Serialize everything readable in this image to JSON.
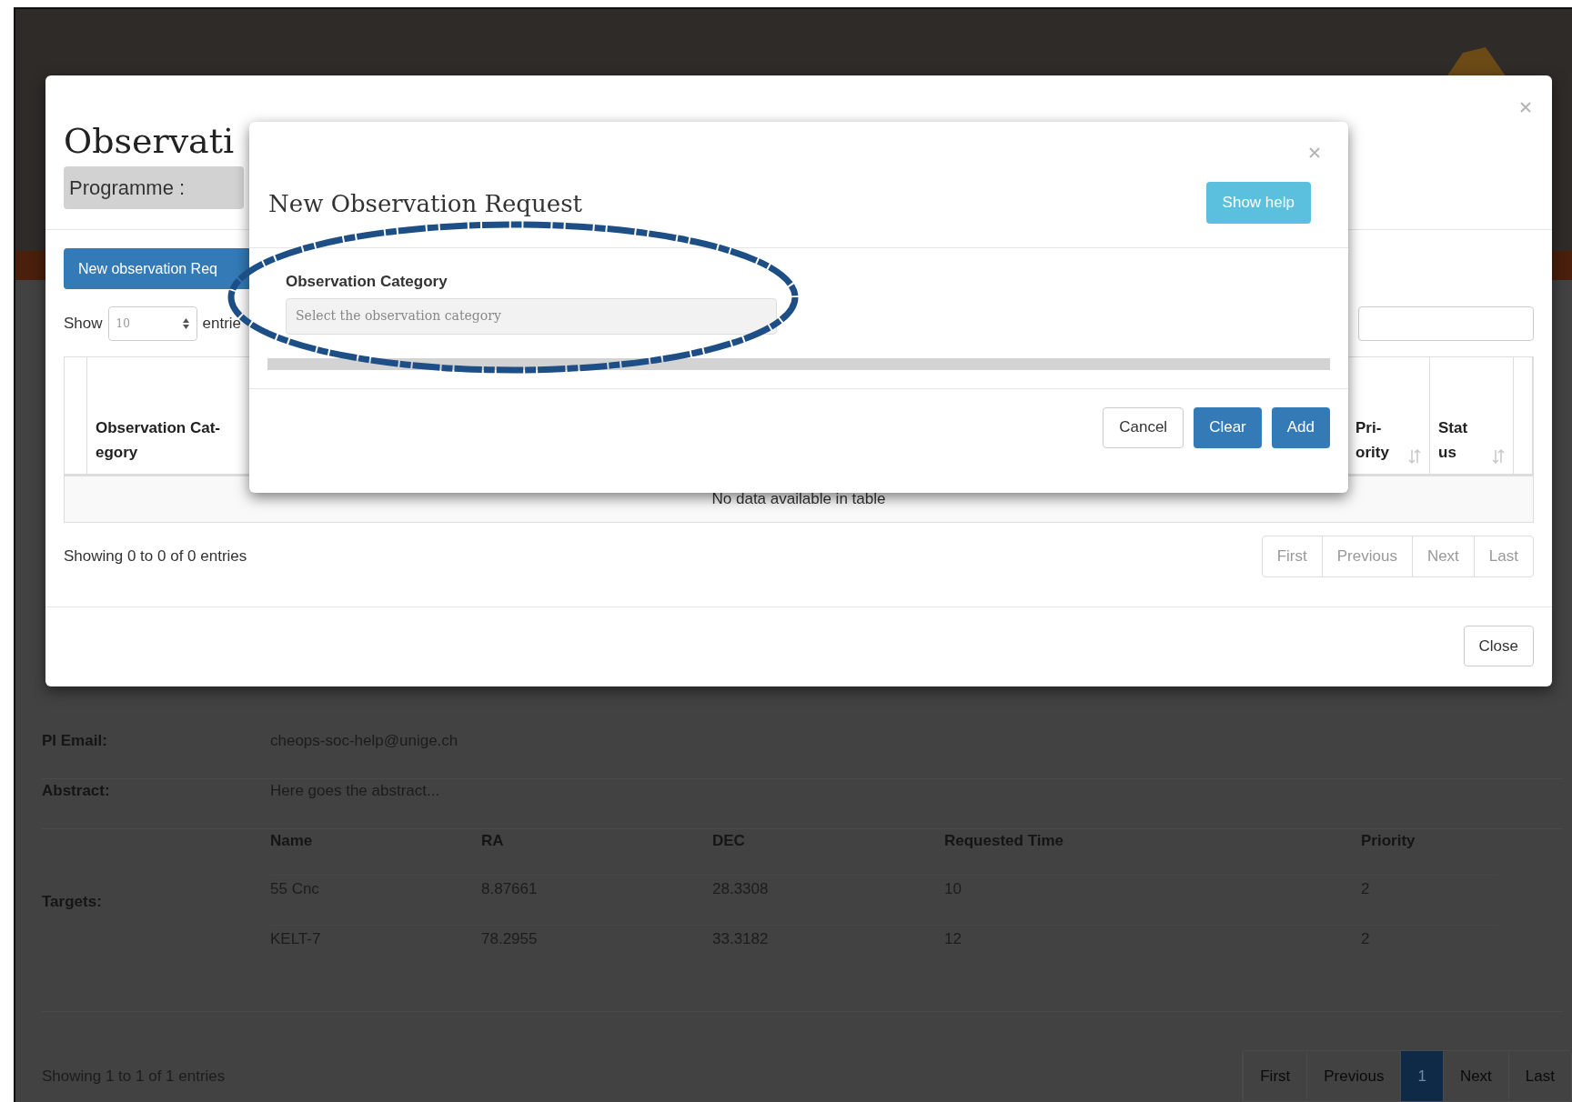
{
  "page": {
    "details": [
      {
        "label": "PI Email:",
        "value": "cheops-soc-help@unige.ch"
      },
      {
        "label": "Abstract:",
        "value": "Here goes the abstract..."
      }
    ],
    "targets": {
      "label": "Targets:",
      "columns": [
        "Name",
        "RA",
        "DEC",
        "Requested Time",
        "Priority"
      ],
      "rows": [
        [
          "55 Cnc",
          "8.87661",
          "28.3308",
          "10",
          "2"
        ],
        [
          "KELT-7",
          "78.2955",
          "33.3182",
          "12",
          "2"
        ]
      ]
    },
    "info": "Showing 1 to 1 of 1 entries",
    "pagination": [
      {
        "label": "First",
        "selected": false
      },
      {
        "label": "Previous",
        "selected": false
      },
      {
        "label": "1",
        "selected": true
      },
      {
        "label": "Next",
        "selected": false
      },
      {
        "label": "Last",
        "selected": false
      }
    ]
  },
  "outer_modal": {
    "title": "Observati",
    "programme_label": "Programme :",
    "new_button": "New observation Req",
    "show_label": "Show",
    "page_size": "10",
    "entries_label": "entrie",
    "columns": [
      {},
      {
        "lines": [
          "Observation Cat-",
          "egory"
        ]
      },
      {
        "lines": [
          "Pri-",
          "ority"
        ],
        "sortable": true
      },
      {
        "lines": [
          "Stat",
          "us"
        ],
        "sortable": true
      },
      {}
    ],
    "empty_message": "No data available in table",
    "info": "Showing 0 to 0 of 0 entries",
    "pagination": [
      "First",
      "Previous",
      "Next",
      "Last"
    ],
    "close_button": "Close"
  },
  "inner_modal": {
    "title": "New Observation Request",
    "help_button": "Show help",
    "field_label": "Observation Category",
    "field_placeholder": "Select the observation category",
    "buttons": [
      {
        "label": "Cancel",
        "kind": "default"
      },
      {
        "label": "Clear",
        "kind": "primary"
      },
      {
        "label": "Add",
        "kind": "primary"
      }
    ]
  }
}
